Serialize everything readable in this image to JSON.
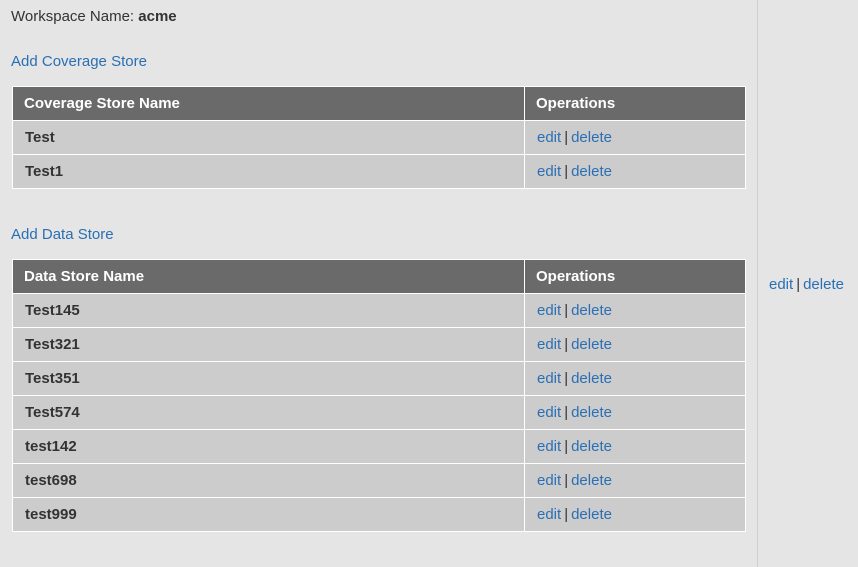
{
  "workspace": {
    "label": "Workspace Name:",
    "value": "acme"
  },
  "coverage": {
    "add_link": "Add Coverage Store",
    "headers": [
      "Coverage Store Name",
      "Operations"
    ],
    "rows": [
      {
        "name": "Test",
        "edit": "edit",
        "sep": "|",
        "delete": "delete"
      },
      {
        "name": "Test1",
        "edit": "edit",
        "sep": "|",
        "delete": "delete"
      }
    ]
  },
  "datastore": {
    "add_link": "Add Data Store",
    "headers": [
      "Data Store Name",
      "Operations"
    ],
    "rows": [
      {
        "name": "Test145",
        "edit": "edit",
        "sep": "|",
        "delete": "delete"
      },
      {
        "name": "Test321",
        "edit": "edit",
        "sep": "|",
        "delete": "delete"
      },
      {
        "name": "Test351",
        "edit": "edit",
        "sep": "|",
        "delete": "delete"
      },
      {
        "name": "Test574",
        "edit": "edit",
        "sep": "|",
        "delete": "delete"
      },
      {
        "name": "test142",
        "edit": "edit",
        "sep": "|",
        "delete": "delete"
      },
      {
        "name": "test698",
        "edit": "edit",
        "sep": "|",
        "delete": "delete"
      },
      {
        "name": "test999",
        "edit": "edit",
        "sep": "|",
        "delete": "delete"
      }
    ]
  },
  "side": {
    "edit": "edit",
    "sep": "|",
    "delete": "delete"
  },
  "colors": {
    "link": "#2a6fb4",
    "header_bg": "#6a6a6a",
    "row_bg": "#cccccc",
    "page_bg": "#e5e5e5"
  }
}
